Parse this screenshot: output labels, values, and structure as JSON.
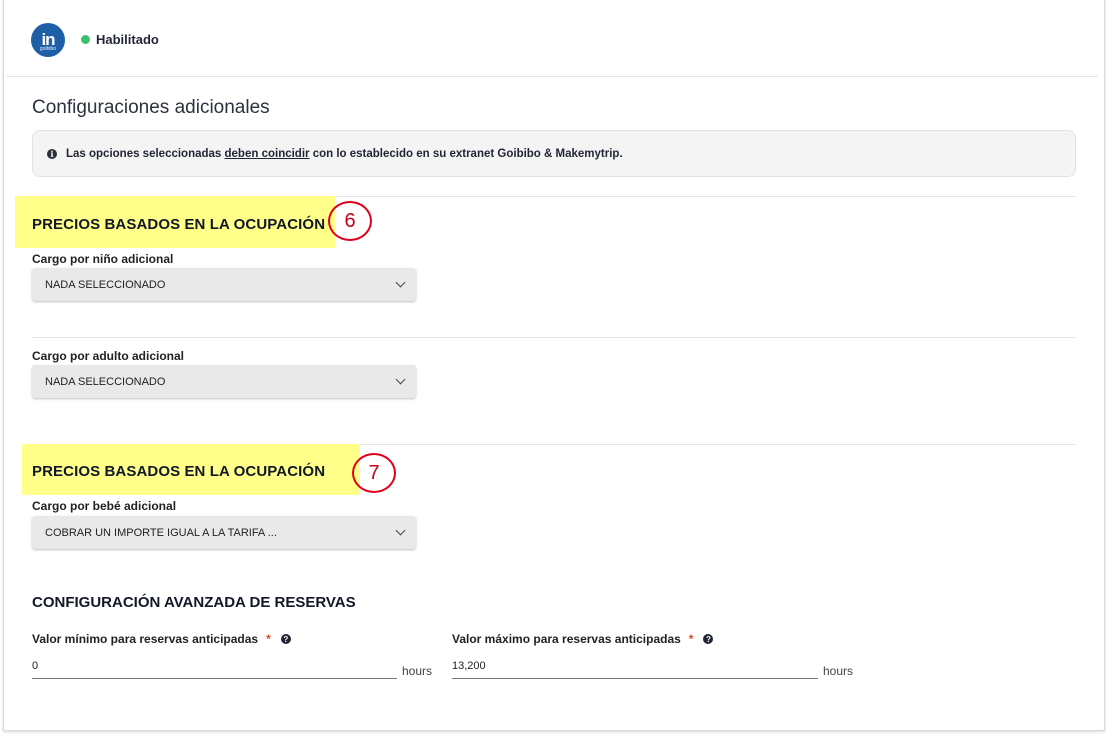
{
  "header": {
    "logo_text": "in",
    "logo_sub": "goibibo",
    "status_label": "Habilitado",
    "status_color": "#3dbf6e"
  },
  "page": {
    "section_title": "Configuraciones adicionales"
  },
  "notice": {
    "icon": "info-icon",
    "text_before": "Las opciones seleccionadas ",
    "text_underlined": "deben coincidir",
    "text_after": " con lo establecido en su extranet Goibibo & Makemytrip."
  },
  "group1": {
    "title": "PRECIOS BASADOS EN LA OCUPACIÓN",
    "callout": "6",
    "child_label": "Cargo por niño adicional",
    "child_value": "NADA SELECCIONADO",
    "adult_label": "Cargo por adulto adicional",
    "adult_value": "NADA SELECCIONADO"
  },
  "group2": {
    "title": "PRECIOS BASADOS EN LA OCUPACIÓN",
    "callout": "7",
    "infant_label": "Cargo por bebé adicional",
    "infant_value": "COBRAR UN IMPORTE IGUAL A LA TARIFA ..."
  },
  "advanced": {
    "title": "CONFIGURACIÓN AVANZADA DE RESERVAS",
    "min_label": "Valor mínimo para reservas anticipadas",
    "min_value": "0",
    "min_unit": "hours",
    "max_label": "Valor máximo para reservas anticipadas",
    "max_value": "13,200",
    "max_unit": "hours",
    "required_mark": "*",
    "help_glyph": "?"
  },
  "colors": {
    "highlight": "#ffff8a",
    "callout_border": "#e0001a",
    "required": "#e0452b"
  }
}
